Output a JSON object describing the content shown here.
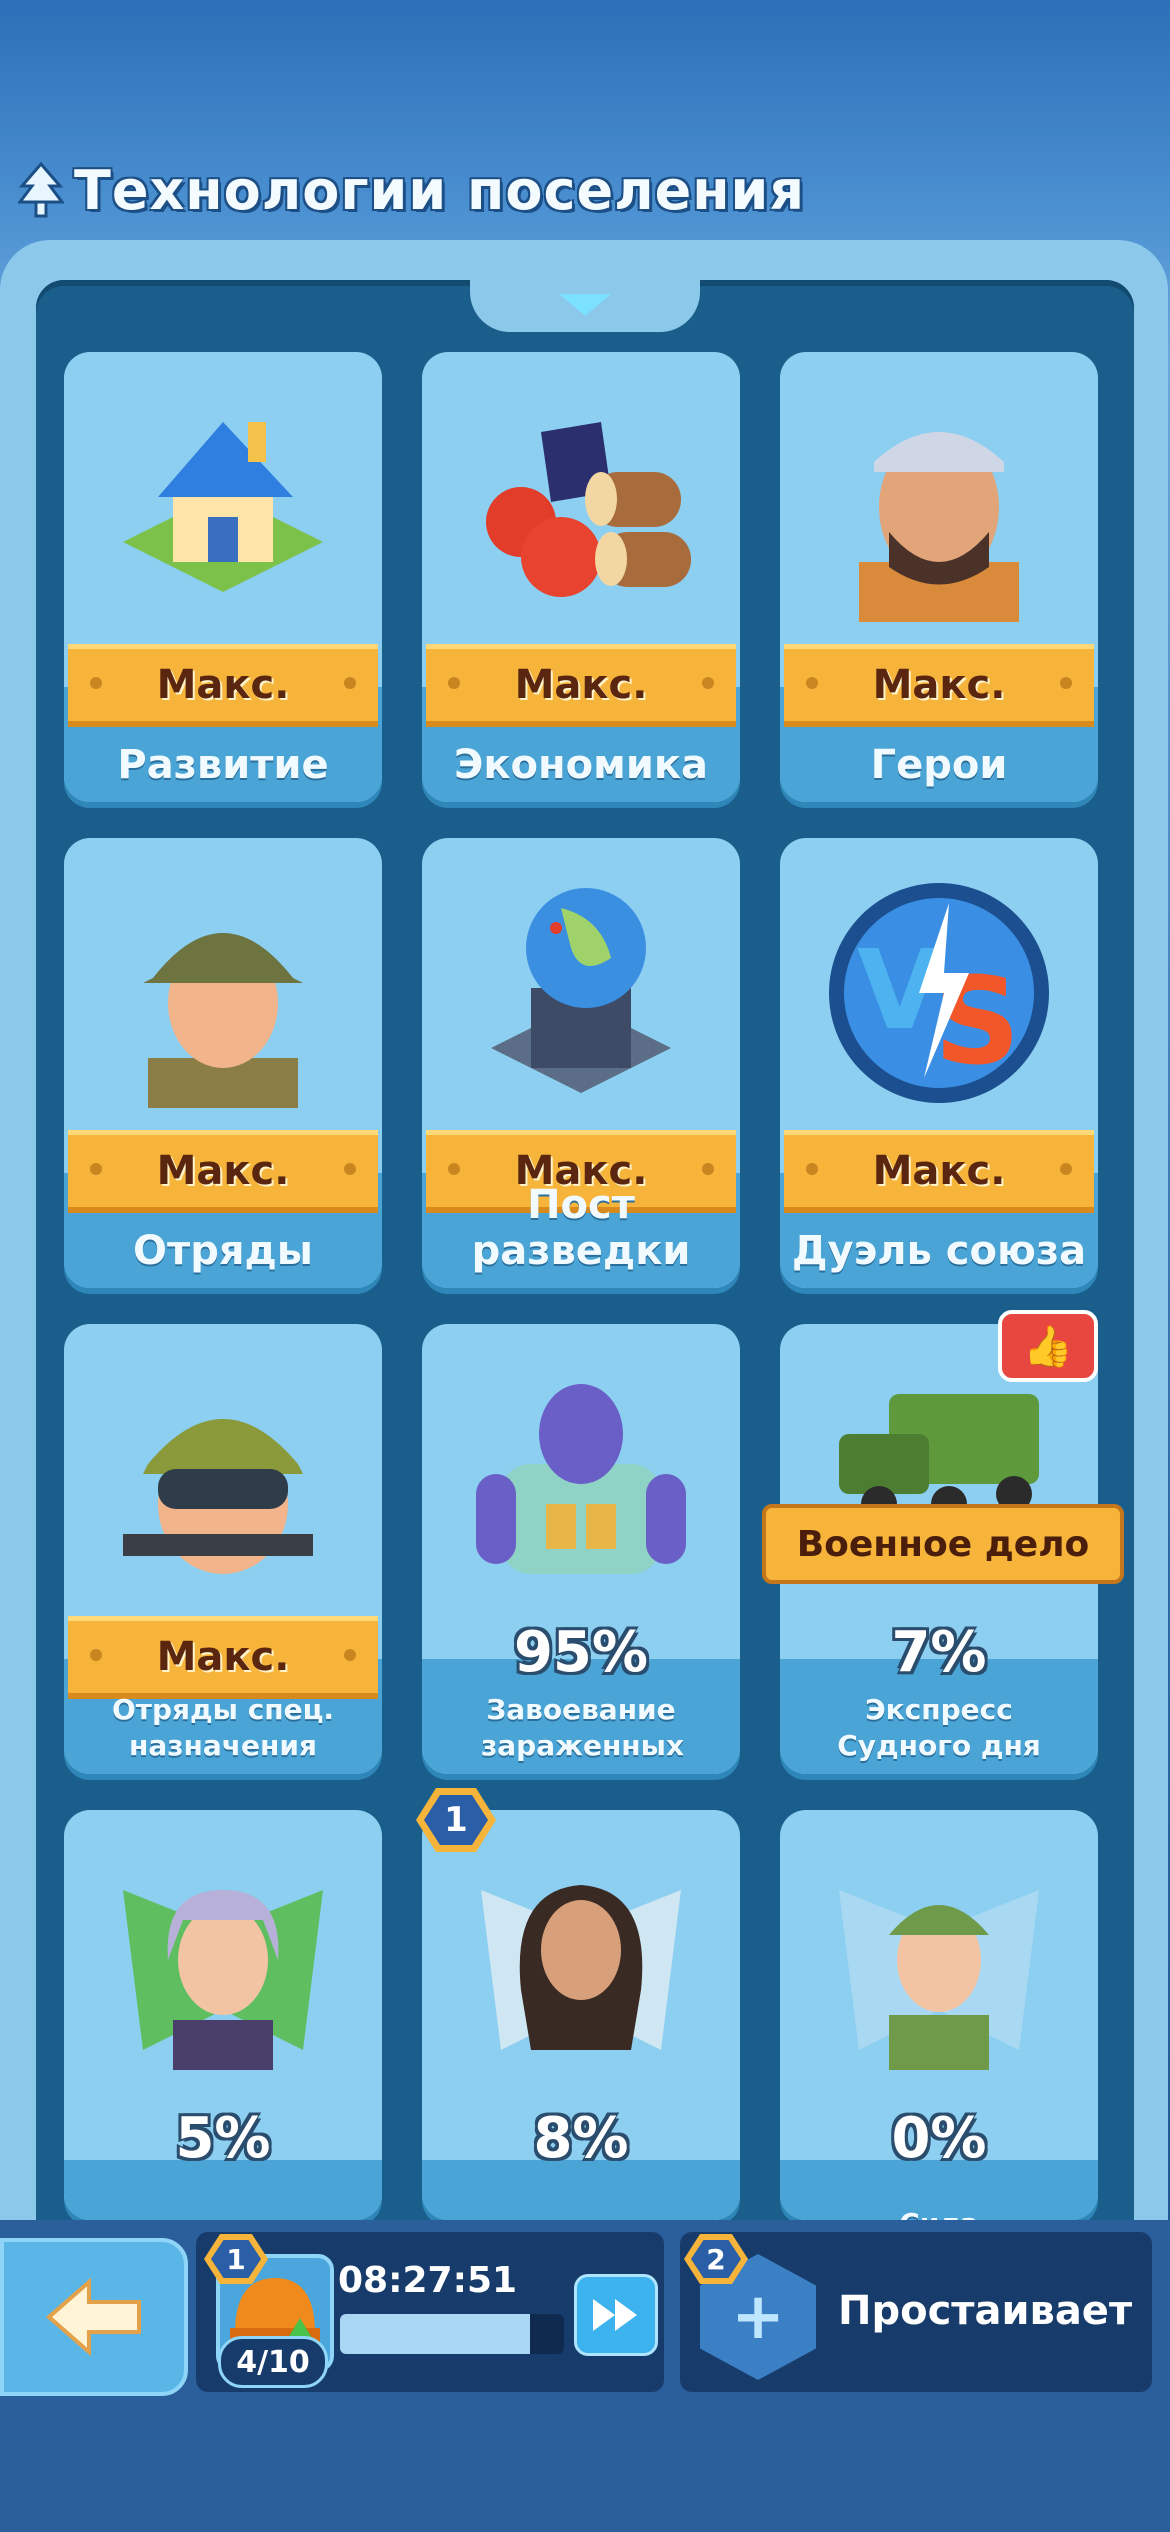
{
  "header": {
    "title": "Технологии поселения"
  },
  "cards": [
    {
      "name": "Развитие",
      "status": "Макс.",
      "icon": "house-icon"
    },
    {
      "name": "Экономика",
      "status": "Макс.",
      "icon": "resources-icon"
    },
    {
      "name": "Герои",
      "status": "Макс.",
      "icon": "hero-icon"
    },
    {
      "name": "Отряды",
      "status": "Макс.",
      "icon": "soldier-icon"
    },
    {
      "name": "Пост разведки",
      "status": "Макс.",
      "icon": "globe-icon"
    },
    {
      "name": "Дуэль союза",
      "status": "Макс.",
      "icon": "versus-icon"
    },
    {
      "name": "Отряды спец. назначения",
      "status": "Макс.",
      "icon": "special-forces-icon"
    },
    {
      "name": "Завоевание зараженных",
      "progress": "95%",
      "icon": "zombie-icon"
    },
    {
      "name": "Экспресс Судного дня",
      "progress": "7%",
      "badge": "Военное дело",
      "icon": "train-icon"
    },
    {
      "name": "",
      "progress": "5%",
      "icon": "hero-girl-icon"
    },
    {
      "name": "",
      "progress": "8%",
      "notification": "1",
      "icon": "hero-woman-icon"
    },
    {
      "name": "Сила",
      "progress": "0%",
      "icon": "hero-soldier-girl-icon"
    }
  ],
  "footer": {
    "worker_badge": "1",
    "worker_count": "4/10",
    "timer": "08:27:51",
    "progress_fraction": 0.85,
    "help_badge": "2",
    "help_label": "Простаивает"
  }
}
